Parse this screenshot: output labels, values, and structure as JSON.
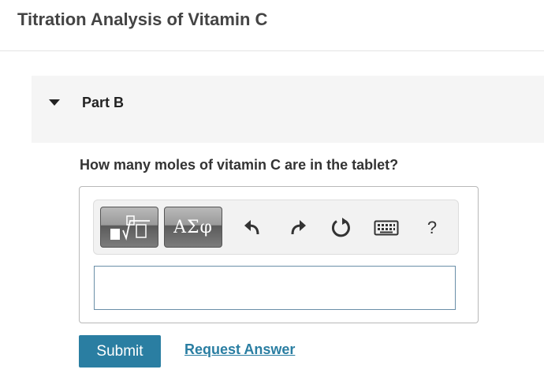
{
  "page": {
    "title": "Titration Analysis of Vitamin C"
  },
  "part": {
    "label": "Part B"
  },
  "question": {
    "text": "How many moles of vitamin C are in the tablet?"
  },
  "toolbar": {
    "symbols_label": "ΑΣφ",
    "help_label": "?",
    "icons": [
      "templates-icon",
      "undo-icon",
      "redo-icon",
      "reset-icon",
      "keyboard-icon"
    ]
  },
  "actions": {
    "submit_label": "Submit",
    "request_answer_label": "Request Answer"
  },
  "colors": {
    "accent": "#2a7ea2",
    "toolbar_bg": "#f2f2f2",
    "header_bg": "#f5f5f5"
  }
}
